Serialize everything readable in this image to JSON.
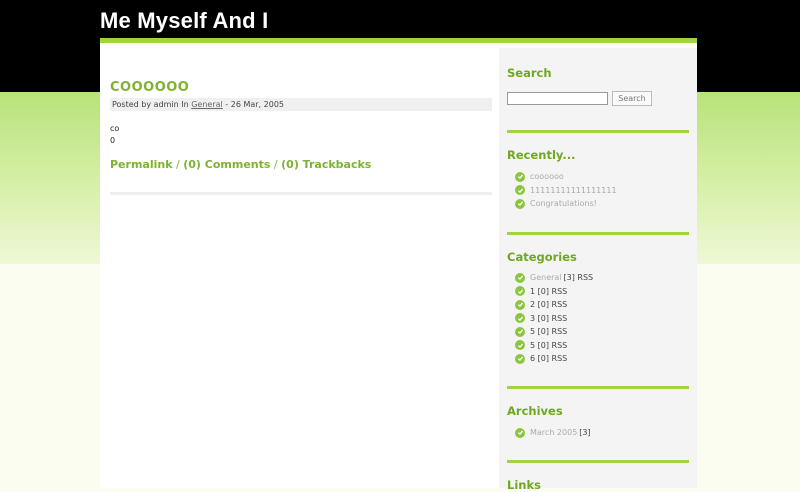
{
  "site": {
    "title": "Me Myself And I"
  },
  "post": {
    "title": "COOOOOO",
    "meta_prefix": "Posted by admin In",
    "meta_category": "General",
    "meta_suffix": " - 26 Mar, 2005",
    "body_lines": [
      "co",
      "0"
    ],
    "permalink": "Permalink",
    "sep": " / ",
    "comments": "(0) Comments",
    "trackbacks": "(0) Trackbacks"
  },
  "sidebar": {
    "search": {
      "heading": "Search",
      "input_value": "",
      "button_label": "Search"
    },
    "recently": {
      "heading": "Recently...",
      "items": [
        "coooooo",
        "11111111111111111",
        "Congratulations!"
      ]
    },
    "categories": {
      "heading": "Categories",
      "items": [
        {
          "name": "General",
          "count": "[3]",
          "rss": "RSS"
        },
        {
          "name": "1",
          "count": "[0]",
          "rss": "RSS"
        },
        {
          "name": "2",
          "count": "[0]",
          "rss": "RSS"
        },
        {
          "name": "3",
          "count": "[0]",
          "rss": "RSS"
        },
        {
          "name": "5",
          "count": "[0]",
          "rss": "RSS"
        },
        {
          "name": "5",
          "count": "[0]",
          "rss": "RSS"
        },
        {
          "name": "6",
          "count": "[0]",
          "rss": "RSS"
        }
      ]
    },
    "archives": {
      "heading": "Archives",
      "items": [
        {
          "name": "March 2005",
          "count": "[3]"
        }
      ]
    },
    "links": {
      "heading": "Links"
    }
  },
  "colors": {
    "accent": "#7fb22f",
    "rule": "#9fd43f",
    "header_bg": "#000000"
  },
  "icons": {
    "bullet": "check-circle-icon"
  }
}
